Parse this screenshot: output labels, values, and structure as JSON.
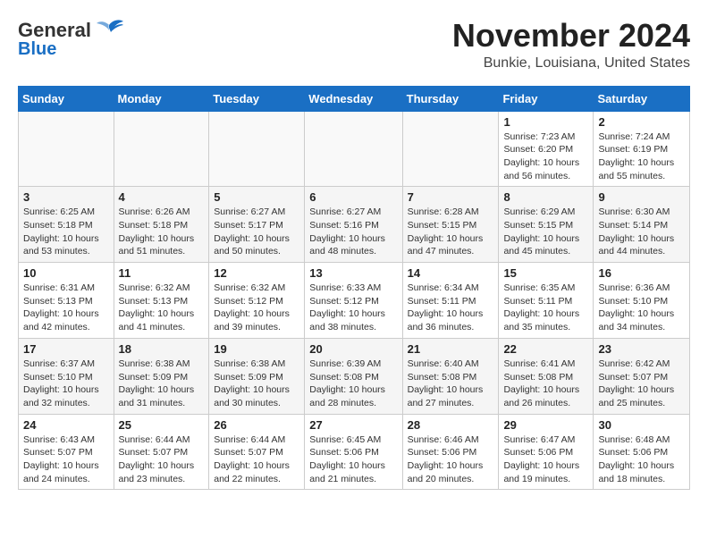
{
  "header": {
    "logo_line1": "General",
    "logo_line2": "Blue",
    "month": "November 2024",
    "location": "Bunkie, Louisiana, United States"
  },
  "weekdays": [
    "Sunday",
    "Monday",
    "Tuesday",
    "Wednesday",
    "Thursday",
    "Friday",
    "Saturday"
  ],
  "weeks": [
    [
      {
        "day": "",
        "info": ""
      },
      {
        "day": "",
        "info": ""
      },
      {
        "day": "",
        "info": ""
      },
      {
        "day": "",
        "info": ""
      },
      {
        "day": "",
        "info": ""
      },
      {
        "day": "1",
        "info": "Sunrise: 7:23 AM\nSunset: 6:20 PM\nDaylight: 10 hours\nand 56 minutes."
      },
      {
        "day": "2",
        "info": "Sunrise: 7:24 AM\nSunset: 6:19 PM\nDaylight: 10 hours\nand 55 minutes."
      }
    ],
    [
      {
        "day": "3",
        "info": "Sunrise: 6:25 AM\nSunset: 5:18 PM\nDaylight: 10 hours\nand 53 minutes."
      },
      {
        "day": "4",
        "info": "Sunrise: 6:26 AM\nSunset: 5:18 PM\nDaylight: 10 hours\nand 51 minutes."
      },
      {
        "day": "5",
        "info": "Sunrise: 6:27 AM\nSunset: 5:17 PM\nDaylight: 10 hours\nand 50 minutes."
      },
      {
        "day": "6",
        "info": "Sunrise: 6:27 AM\nSunset: 5:16 PM\nDaylight: 10 hours\nand 48 minutes."
      },
      {
        "day": "7",
        "info": "Sunrise: 6:28 AM\nSunset: 5:15 PM\nDaylight: 10 hours\nand 47 minutes."
      },
      {
        "day": "8",
        "info": "Sunrise: 6:29 AM\nSunset: 5:15 PM\nDaylight: 10 hours\nand 45 minutes."
      },
      {
        "day": "9",
        "info": "Sunrise: 6:30 AM\nSunset: 5:14 PM\nDaylight: 10 hours\nand 44 minutes."
      }
    ],
    [
      {
        "day": "10",
        "info": "Sunrise: 6:31 AM\nSunset: 5:13 PM\nDaylight: 10 hours\nand 42 minutes."
      },
      {
        "day": "11",
        "info": "Sunrise: 6:32 AM\nSunset: 5:13 PM\nDaylight: 10 hours\nand 41 minutes."
      },
      {
        "day": "12",
        "info": "Sunrise: 6:32 AM\nSunset: 5:12 PM\nDaylight: 10 hours\nand 39 minutes."
      },
      {
        "day": "13",
        "info": "Sunrise: 6:33 AM\nSunset: 5:12 PM\nDaylight: 10 hours\nand 38 minutes."
      },
      {
        "day": "14",
        "info": "Sunrise: 6:34 AM\nSunset: 5:11 PM\nDaylight: 10 hours\nand 36 minutes."
      },
      {
        "day": "15",
        "info": "Sunrise: 6:35 AM\nSunset: 5:11 PM\nDaylight: 10 hours\nand 35 minutes."
      },
      {
        "day": "16",
        "info": "Sunrise: 6:36 AM\nSunset: 5:10 PM\nDaylight: 10 hours\nand 34 minutes."
      }
    ],
    [
      {
        "day": "17",
        "info": "Sunrise: 6:37 AM\nSunset: 5:10 PM\nDaylight: 10 hours\nand 32 minutes."
      },
      {
        "day": "18",
        "info": "Sunrise: 6:38 AM\nSunset: 5:09 PM\nDaylight: 10 hours\nand 31 minutes."
      },
      {
        "day": "19",
        "info": "Sunrise: 6:38 AM\nSunset: 5:09 PM\nDaylight: 10 hours\nand 30 minutes."
      },
      {
        "day": "20",
        "info": "Sunrise: 6:39 AM\nSunset: 5:08 PM\nDaylight: 10 hours\nand 28 minutes."
      },
      {
        "day": "21",
        "info": "Sunrise: 6:40 AM\nSunset: 5:08 PM\nDaylight: 10 hours\nand 27 minutes."
      },
      {
        "day": "22",
        "info": "Sunrise: 6:41 AM\nSunset: 5:08 PM\nDaylight: 10 hours\nand 26 minutes."
      },
      {
        "day": "23",
        "info": "Sunrise: 6:42 AM\nSunset: 5:07 PM\nDaylight: 10 hours\nand 25 minutes."
      }
    ],
    [
      {
        "day": "24",
        "info": "Sunrise: 6:43 AM\nSunset: 5:07 PM\nDaylight: 10 hours\nand 24 minutes."
      },
      {
        "day": "25",
        "info": "Sunrise: 6:44 AM\nSunset: 5:07 PM\nDaylight: 10 hours\nand 23 minutes."
      },
      {
        "day": "26",
        "info": "Sunrise: 6:44 AM\nSunset: 5:07 PM\nDaylight: 10 hours\nand 22 minutes."
      },
      {
        "day": "27",
        "info": "Sunrise: 6:45 AM\nSunset: 5:06 PM\nDaylight: 10 hours\nand 21 minutes."
      },
      {
        "day": "28",
        "info": "Sunrise: 6:46 AM\nSunset: 5:06 PM\nDaylight: 10 hours\nand 20 minutes."
      },
      {
        "day": "29",
        "info": "Sunrise: 6:47 AM\nSunset: 5:06 PM\nDaylight: 10 hours\nand 19 minutes."
      },
      {
        "day": "30",
        "info": "Sunrise: 6:48 AM\nSunset: 5:06 PM\nDaylight: 10 hours\nand 18 minutes."
      }
    ]
  ]
}
